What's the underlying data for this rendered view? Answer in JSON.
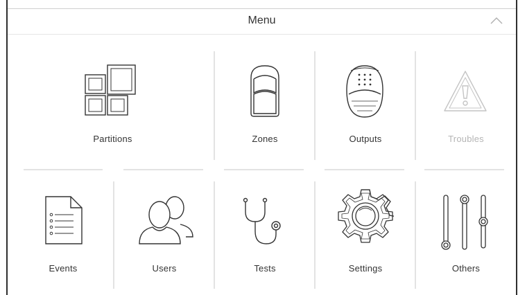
{
  "header": {
    "title": "Menu",
    "collapse_icon": "chevron-up-icon"
  },
  "tiles": {
    "partitions": {
      "label": "Partitions",
      "icon": "partitions-icon"
    },
    "zones": {
      "label": "Zones",
      "icon": "motion-detector-icon"
    },
    "outputs": {
      "label": "Outputs",
      "icon": "siren-icon"
    },
    "troubles": {
      "label": "Troubles",
      "icon": "warning-triangle-icon",
      "disabled": true
    },
    "events": {
      "label": "Events",
      "icon": "document-list-icon"
    },
    "users": {
      "label": "Users",
      "icon": "users-icon"
    },
    "tests": {
      "label": "Tests",
      "icon": "stethoscope-icon"
    },
    "settings": {
      "label": "Settings",
      "icon": "gear-icon"
    },
    "others": {
      "label": "Others",
      "icon": "sliders-icon"
    }
  },
  "colors": {
    "line": "#e3e3e3",
    "icon": "#333333",
    "disabled": "#b5b5b5",
    "frame": "#2e2e2e"
  }
}
